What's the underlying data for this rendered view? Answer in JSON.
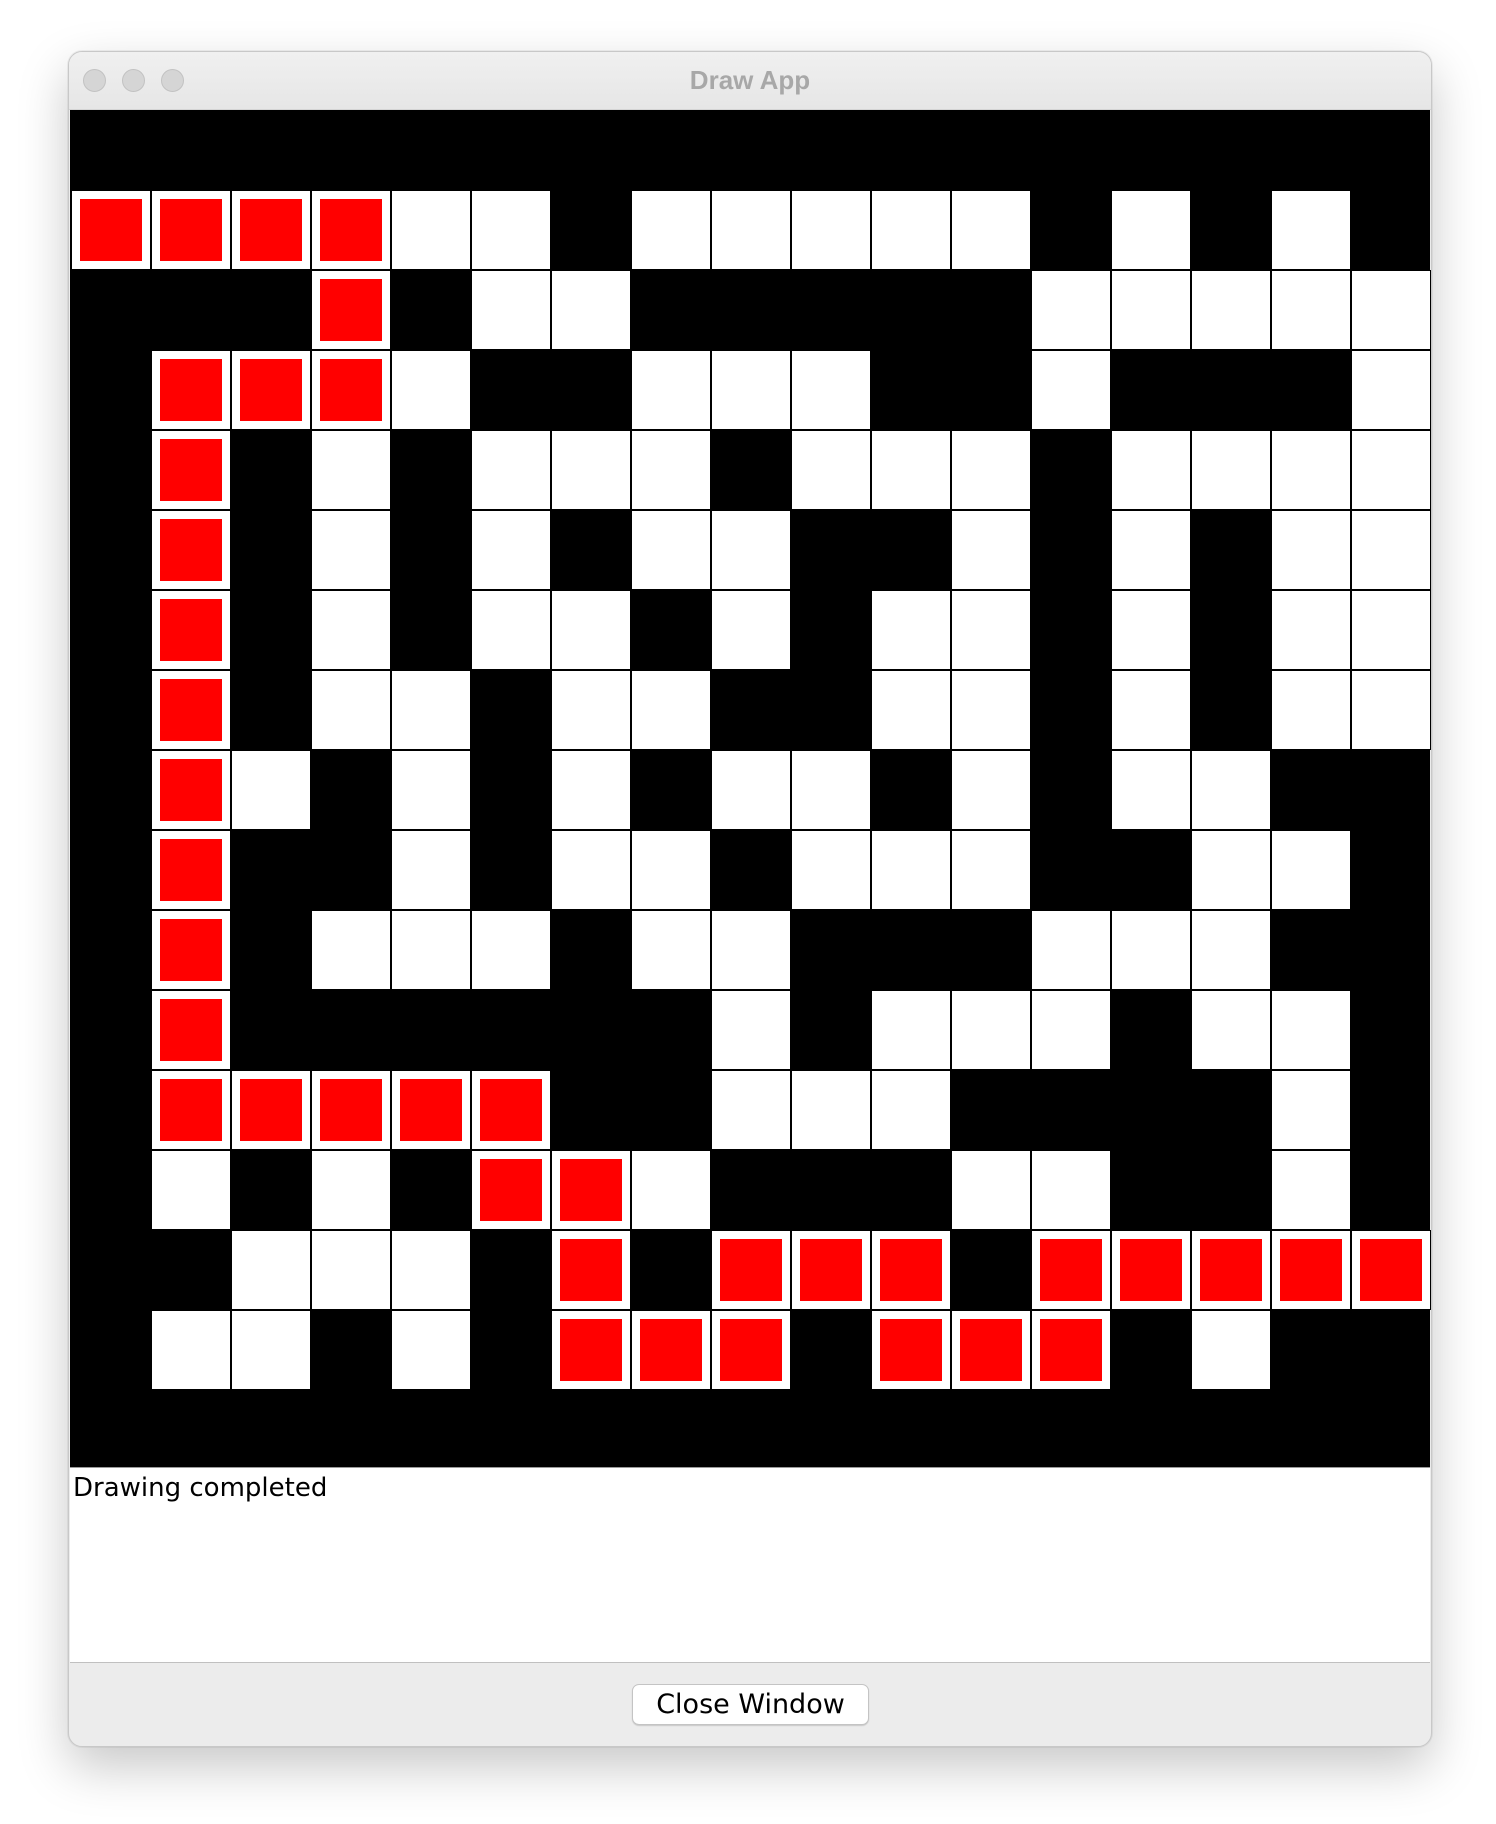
{
  "window": {
    "title": "Draw App"
  },
  "colors": {
    "wall": "#000000",
    "open": "#ffffff",
    "path": "#ff0000"
  },
  "maze": {
    "rows": [
      "RRRR..#.....#.#.",
      "###R#..#####.....",
      "#RRR.##...##.###.",
      "#R#.#...#...#....",
      "#R#.#.#..##.#.#..",
      "#R#.#..#.#..#.#..",
      "#R#..#..##..#.#..",
      "#R.#.#.#..#.#..#",
      "#R##.#..#...##..#",
      "#R#...#..###...#",
      "#R######.#...#..#",
      "#RRRRR##...####.#",
      "#.#.#RR.###..##.#",
      "##...#R#RRR#RRRRR",
      "#..#.#RRR#RRR#.##"
    ]
  },
  "status": {
    "message": "Drawing completed"
  },
  "footer": {
    "close_label": "Close Window"
  }
}
